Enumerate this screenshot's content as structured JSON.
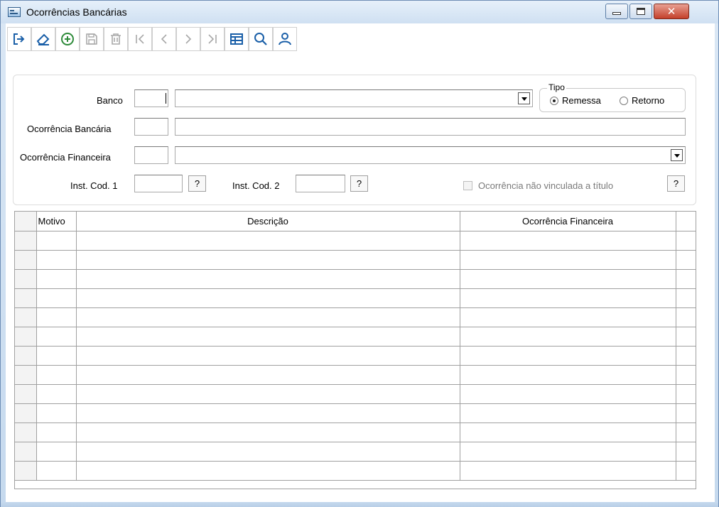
{
  "window": {
    "title": "Ocorrências Bancárias"
  },
  "toolbar": {
    "buttons": [
      {
        "name": "exit",
        "icon": "exit-icon",
        "enabled": true
      },
      {
        "name": "clear",
        "icon": "eraser-icon",
        "enabled": true
      },
      {
        "name": "new",
        "icon": "add-circle-icon",
        "enabled": true
      },
      {
        "name": "save",
        "icon": "save-icon",
        "enabled": false
      },
      {
        "name": "delete",
        "icon": "trash-icon",
        "enabled": false
      },
      {
        "name": "first",
        "icon": "first-record-icon",
        "enabled": false
      },
      {
        "name": "previous",
        "icon": "previous-record-icon",
        "enabled": false
      },
      {
        "name": "next",
        "icon": "next-record-icon",
        "enabled": false
      },
      {
        "name": "last",
        "icon": "last-record-icon",
        "enabled": false
      },
      {
        "name": "grid",
        "icon": "table-icon",
        "enabled": true
      },
      {
        "name": "search",
        "icon": "search-icon",
        "enabled": true
      },
      {
        "name": "user",
        "icon": "user-icon",
        "enabled": true
      }
    ]
  },
  "form": {
    "banco_label": "Banco",
    "banco_code": "",
    "banco_name": "",
    "ocorrencia_bancaria_label": "Ocorrência Bancária",
    "ocorrencia_bancaria_code": "",
    "ocorrencia_bancaria_desc": "",
    "ocorrencia_financeira_label": "Ocorrência Financeira",
    "ocorrencia_financeira_code": "",
    "ocorrencia_financeira_name": "",
    "inst_cod1_label": "Inst. Cod. 1",
    "inst_cod1_value": "",
    "inst_cod2_label": "Inst. Cod. 2",
    "inst_cod2_value": "",
    "help_label": "?",
    "nao_vinculada_label": "Ocorrência não vinculada a título",
    "nao_vinculada_checked": false
  },
  "tipo": {
    "legend": "Tipo",
    "options": [
      "Remessa",
      "Retorno"
    ],
    "selected": "Remessa"
  },
  "grid": {
    "columns": [
      "Motivo",
      "Descrição",
      "Ocorrência Financeira"
    ],
    "empty_rows": 13
  },
  "colors": {
    "title_bg": "#dbe8f5",
    "close_button": "#c4402b",
    "toolbar_icon": "#1a5fa8",
    "toolbar_icon_disabled": "#a8a8a8",
    "add_icon": "#2e8b3a"
  }
}
